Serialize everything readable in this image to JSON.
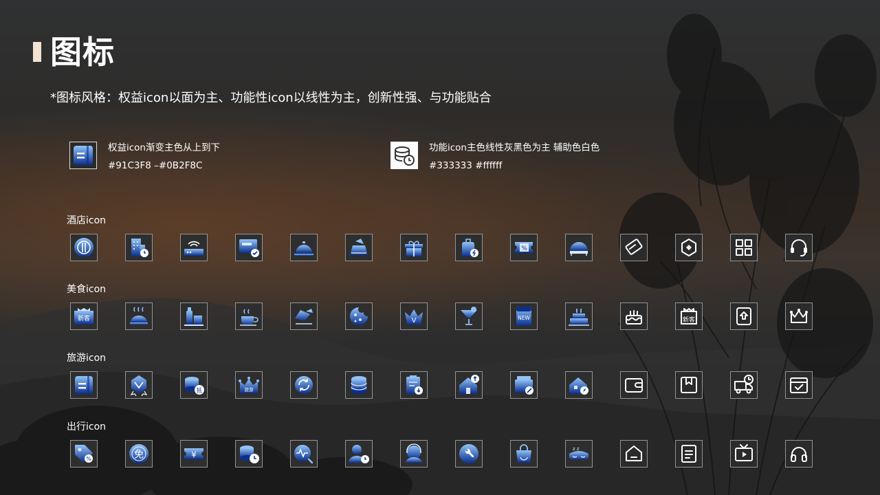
{
  "page_title": "图标",
  "subtitle": "*图标风格：权益icon以面为主、功能性icon以线性为主，创新性强、与功能贴合",
  "legends": {
    "rights": {
      "line1": "权益icon渐变主色从上到下",
      "line2": "#91C3F8 –#0B2F8C"
    },
    "function": {
      "line1": "功能icon主色线性灰黑色为主 辅助色白色",
      "line2": "#333333    #ffffff"
    }
  },
  "colors": {
    "gradient_top": "#91C3F8",
    "gradient_bottom": "#0B2F8C",
    "line_main": "#333333",
    "line_aux": "#ffffff"
  },
  "rows": [
    {
      "label": "酒店icon",
      "icons": [
        {
          "name": "dining-plate-icon",
          "style": "gradient"
        },
        {
          "name": "hotel-building-clock-icon",
          "style": "gradient"
        },
        {
          "name": "wifi-router-icon",
          "style": "gradient"
        },
        {
          "name": "room-card-check-icon",
          "style": "gradient"
        },
        {
          "name": "service-bell-icon",
          "style": "gradient"
        },
        {
          "name": "laundry-icon",
          "style": "gradient"
        },
        {
          "name": "gift-box-icon",
          "style": "gradient"
        },
        {
          "name": "luggage-icon",
          "style": "gradient"
        },
        {
          "name": "discount-ticket-icon",
          "style": "gradient"
        },
        {
          "name": "canopy-bed-icon",
          "style": "gradient"
        },
        {
          "name": "room-key-card-icon",
          "style": "line"
        },
        {
          "name": "diamond-badge-icon",
          "style": "line"
        },
        {
          "name": "grid-apps-icon",
          "style": "line"
        },
        {
          "name": "headset-icon",
          "style": "line"
        }
      ]
    },
    {
      "label": "美食icon",
      "icons": [
        {
          "name": "new-customer-shop-icon",
          "style": "gradient",
          "text": "新客"
        },
        {
          "name": "steamed-bun-icon",
          "style": "gradient"
        },
        {
          "name": "bottle-city-icon",
          "style": "gradient"
        },
        {
          "name": "hot-coffee-icon",
          "style": "gradient"
        },
        {
          "name": "food-delivery-icon",
          "style": "gradient"
        },
        {
          "name": "cookie-icon",
          "style": "gradient"
        },
        {
          "name": "vip-crown-icon",
          "style": "gradient"
        },
        {
          "name": "cocktail-icon",
          "style": "gradient"
        },
        {
          "name": "new-tag-icon",
          "style": "gradient",
          "text": "NEW"
        },
        {
          "name": "birthday-cake-icon",
          "style": "gradient"
        },
        {
          "name": "birthday-cake-line-icon",
          "style": "line"
        },
        {
          "name": "new-customer-line-icon",
          "style": "line",
          "text": "新客"
        },
        {
          "name": "exchange-coupon-icon",
          "style": "line"
        },
        {
          "name": "crown-line-icon",
          "style": "line"
        }
      ]
    },
    {
      "label": "旅游icon",
      "icons": [
        {
          "name": "document-card-icon",
          "style": "gradient"
        },
        {
          "name": "vip-medal-icon",
          "style": "gradient"
        },
        {
          "name": "coins-deduct-icon",
          "style": "gradient",
          "text": "抵"
        },
        {
          "name": "travel-crown-icon",
          "style": "gradient",
          "text": "旅游"
        },
        {
          "name": "cycle-refresh-icon",
          "style": "gradient"
        },
        {
          "name": "coin-stack-icon",
          "style": "gradient"
        },
        {
          "name": "clipboard-download-icon",
          "style": "gradient"
        },
        {
          "name": "house-upload-icon",
          "style": "gradient"
        },
        {
          "name": "card-stack-cancel-icon",
          "style": "gradient"
        },
        {
          "name": "house-compass-icon",
          "style": "gradient"
        },
        {
          "name": "wallet-icon",
          "style": "line"
        },
        {
          "name": "bookmark-book-icon",
          "style": "line"
        },
        {
          "name": "truck-clock-icon",
          "style": "line"
        },
        {
          "name": "calendar-check-icon",
          "style": "line"
        }
      ]
    },
    {
      "label": "出行icon",
      "icons": [
        {
          "name": "discount-tag-icon",
          "style": "gradient"
        },
        {
          "name": "free-coin-icon",
          "style": "gradient",
          "text": "免"
        },
        {
          "name": "yen-ticket-icon",
          "style": "gradient",
          "text": "¥"
        },
        {
          "name": "coins-clock-icon",
          "style": "gradient"
        },
        {
          "name": "pulse-search-icon",
          "style": "gradient"
        },
        {
          "name": "user-clock-icon",
          "style": "gradient"
        },
        {
          "name": "customer-service-icon",
          "style": "gradient"
        },
        {
          "name": "repair-wrench-icon",
          "style": "gradient"
        },
        {
          "name": "shopping-bag-icon",
          "style": "gradient"
        },
        {
          "name": "sleep-mask-icon",
          "style": "gradient"
        },
        {
          "name": "home-line-icon",
          "style": "line"
        },
        {
          "name": "note-document-icon",
          "style": "line"
        },
        {
          "name": "tv-play-icon",
          "style": "line"
        },
        {
          "name": "headphones-icon",
          "style": "line"
        }
      ]
    }
  ]
}
